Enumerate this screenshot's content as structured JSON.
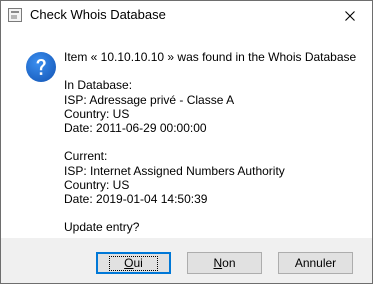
{
  "window": {
    "title": "Check Whois Database"
  },
  "icons": {
    "app": "app-window-icon",
    "close": "close-icon",
    "message": "question-icon"
  },
  "message": {
    "headline": "Item « 10.10.10.10 » was found in the Whois Database",
    "database": {
      "label": "In Database:",
      "isp": "ISP: Adressage privé - Classe A",
      "country": "Country: US",
      "date": "Date: 2011-06-29 00:00:00"
    },
    "current": {
      "label": "Current:",
      "isp": "ISP: Internet Assigned Numbers Authority",
      "country": "Country: US",
      "date": "Date: 2019-01-04 14:50:39"
    },
    "prompt": "Update entry?"
  },
  "buttons": {
    "yes": {
      "mnemonic": "O",
      "rest": "ui"
    },
    "no": {
      "mnemonic": "N",
      "rest": "on"
    },
    "cancel": "Annuler"
  },
  "colors": {
    "accent": "#0078d7",
    "icon_blue": "#1f6fd0",
    "footer_bg": "#f0f0f0"
  }
}
